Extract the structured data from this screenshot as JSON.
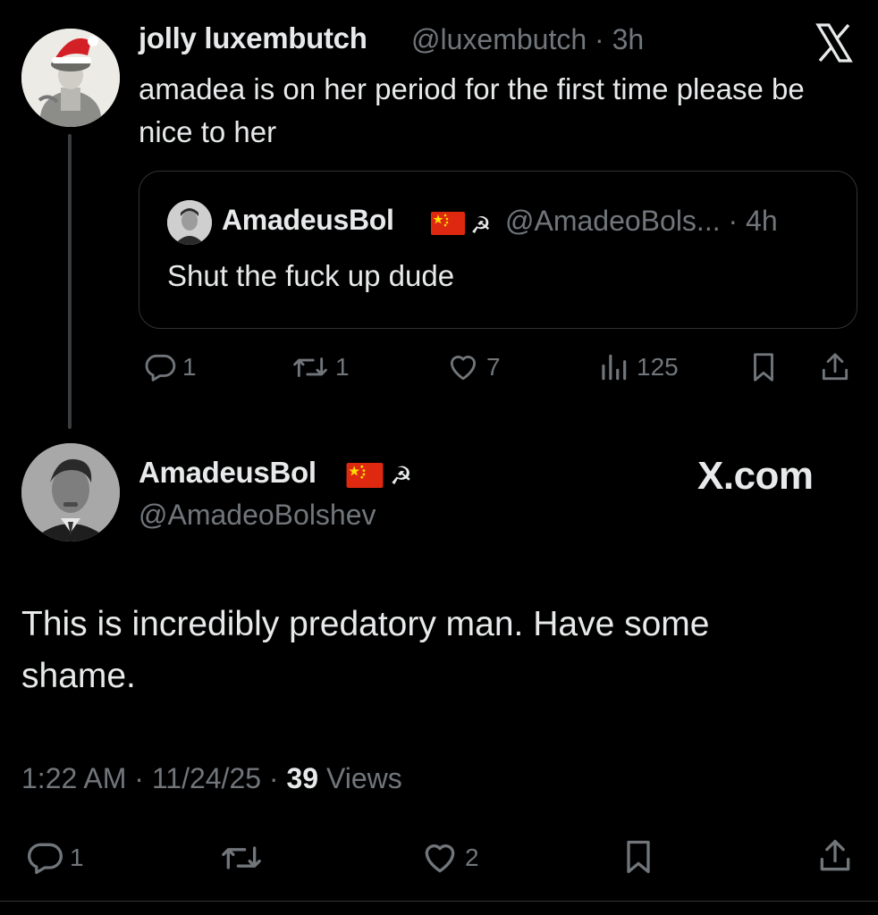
{
  "parent_tweet": {
    "display_name": "jolly luxembutch",
    "handle_time": "@luxembutch · 3h",
    "text": "amadea is on her period for the first time please be nice to her",
    "quote": {
      "display_name": "AmadeusBol",
      "handle_time": "@AmadeoBols... · 4h",
      "sickle": "☭",
      "text": "Shut the fuck up dude"
    },
    "actions": {
      "replies": "1",
      "reposts": "1",
      "likes": "7",
      "views": "125"
    }
  },
  "reply_tweet": {
    "display_name": "AmadeusBol",
    "sickle": "☭",
    "handle": "@AmadeoBolshev",
    "watermark": "X.com",
    "text": "This is incredibly predatory man. Have some shame.",
    "timestamp": "1:22 AM · 11/24/25 · ",
    "views_count": "39",
    "views_label": " Views",
    "actions": {
      "replies": "1",
      "likes": "2"
    }
  },
  "colors": {
    "background": "#000000",
    "text_primary": "#e7e9ea",
    "text_secondary": "#71767b",
    "border": "#2f3336",
    "flag_red": "#de2910",
    "flag_yellow": "#ffde00"
  },
  "icons": [
    "x-logo-icon",
    "reply-icon",
    "repost-icon",
    "like-icon",
    "views-icon",
    "bookmark-icon",
    "share-icon",
    "china-flag-icon"
  ]
}
